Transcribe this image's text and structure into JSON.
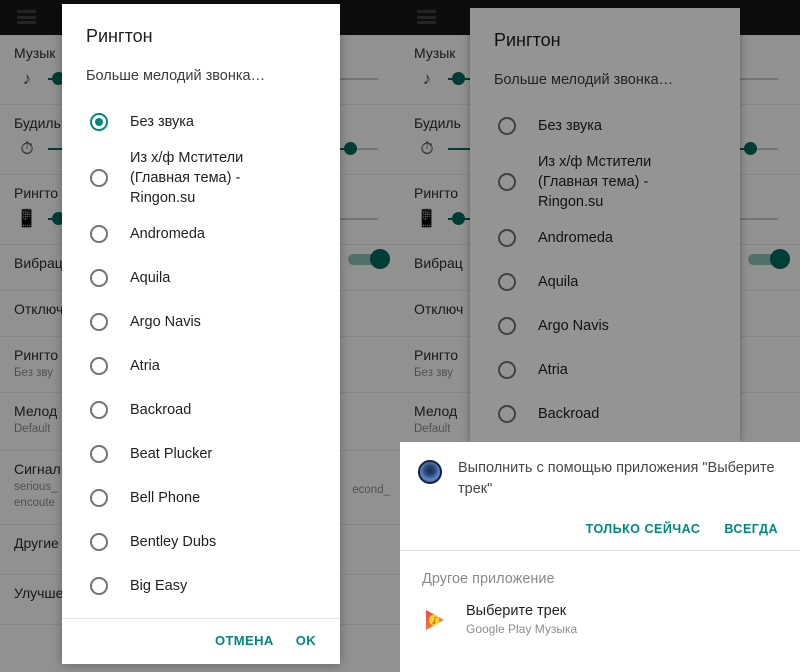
{
  "app": {
    "menu_icon": "hamburger-menu-icon",
    "settings_rows": [
      {
        "title": "Музык",
        "icon": "music-note-icon",
        "control": "slider",
        "value": 12
      },
      {
        "title": "Будиль",
        "icon": "alarm-clock-icon",
        "control": "slider",
        "value": 92
      },
      {
        "title": "Рингто",
        "icon": "vibration-icon",
        "control": "slider",
        "value": 12
      },
      {
        "title": "Вибрац",
        "icon": "none",
        "control": "switch",
        "value": "on"
      },
      {
        "title": "Отключ",
        "icon": "none",
        "control": "none"
      },
      {
        "title": "Рингто",
        "subtitle": "Без зву",
        "control": "none"
      },
      {
        "title": "Мелод",
        "subtitle": "Default",
        "control": "none"
      },
      {
        "title": "Сигнал",
        "subtitle": "serious_",
        "subtitle2": "encoute",
        "subtitle_right": "econd_",
        "control": "none"
      },
      {
        "title": "Другие",
        "control": "none"
      },
      {
        "title": "Улучше",
        "control": "none"
      }
    ]
  },
  "dialog": {
    "title": "Рингтон",
    "subtitle": "Больше мелодий звонка…",
    "options": [
      {
        "label": "Без звука",
        "selected": true
      },
      {
        "label": "Из х/ф Мстители (Главная тема) - Ringon.su",
        "selected": false
      },
      {
        "label": "Andromeda",
        "selected": false
      },
      {
        "label": "Aquila",
        "selected": false
      },
      {
        "label": "Argo Navis",
        "selected": false
      },
      {
        "label": "Atria",
        "selected": false
      },
      {
        "label": "Backroad",
        "selected": false
      },
      {
        "label": "Beat Plucker",
        "selected": false
      },
      {
        "label": "Bell Phone",
        "selected": false
      },
      {
        "label": "Bentley Dubs",
        "selected": false
      },
      {
        "label": "Big Easy",
        "selected": false
      }
    ],
    "cancel_label": "ОТМЕНА",
    "ok_label": "OK"
  },
  "right_dialog": {
    "title": "Рингтон",
    "subtitle": "Больше мелодий звонка…",
    "options": [
      {
        "label": "Без звука",
        "selected": false
      },
      {
        "label": "Из х/ф Мстители (Главная тема) - Ringon.su",
        "selected": false
      },
      {
        "label": "Andromeda",
        "selected": false
      },
      {
        "label": "Aquila",
        "selected": false
      },
      {
        "label": "Argo Navis",
        "selected": false
      },
      {
        "label": "Atria",
        "selected": false
      },
      {
        "label": "Backroad",
        "selected": false
      }
    ]
  },
  "sheet": {
    "icon": "blue-speaker-icon",
    "title": "Выполнить с помощью приложения \"Выберите трек\"",
    "just_once_label": "ТОЛЬКО СЕЙЧАС",
    "always_label": "ВСЕГДА",
    "section_label": "Другое приложение",
    "app": {
      "icon": "google-play-music-icon",
      "name": "Выберите трек",
      "subtitle": "Google Play Музыка"
    }
  },
  "colors": {
    "accent": "#00897b",
    "slider": "#00695c",
    "appbar": "#161719"
  }
}
